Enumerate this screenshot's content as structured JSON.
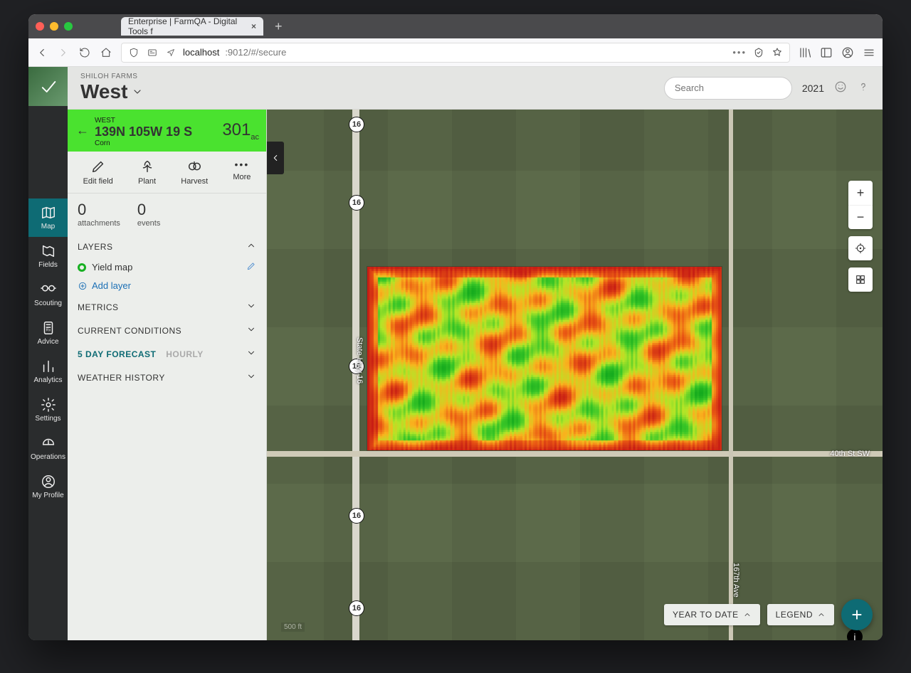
{
  "browser": {
    "tab_title": "Enterprise | FarmQA - Digital Tools f",
    "url_host": "localhost",
    "url_portpath": ":9012/#/secure"
  },
  "header": {
    "org": "SHILOH FARMS",
    "area": "West",
    "search_placeholder": "Search",
    "year": "2021"
  },
  "field": {
    "region": "WEST",
    "name": "139N 105W 19 S",
    "crop": "Corn",
    "acres_value": "301",
    "acres_unit": "ac"
  },
  "actions": {
    "edit": "Edit field",
    "plant": "Plant",
    "harvest": "Harvest",
    "more": "More"
  },
  "stats": {
    "attachments_count": "0",
    "attachments_label": "attachments",
    "events_count": "0",
    "events_label": "events"
  },
  "panel": {
    "layers_title": "LAYERS",
    "yield_map": "Yield map",
    "add_layer": "Add layer",
    "metrics_title": "METRICS",
    "conditions_title": "CURRENT CONDITIONS",
    "forecast_title": "5 DAY FORECAST",
    "hourly": "HOURLY",
    "history_title": "WEATHER HISTORY"
  },
  "rail": {
    "map": "Map",
    "fields": "Fields",
    "scouting": "Scouting",
    "advice": "Advice",
    "analytics": "Analytics",
    "settings": "Settings",
    "operations": "Operations",
    "profile": "My Profile"
  },
  "map": {
    "highway_number": "16",
    "highway_name": "State Hwy 16",
    "road_east": "40th St SW",
    "road_south": "167th Ave",
    "scale": "500 ft",
    "year_to_date": "YEAR TO DATE",
    "legend": "LEGEND"
  }
}
